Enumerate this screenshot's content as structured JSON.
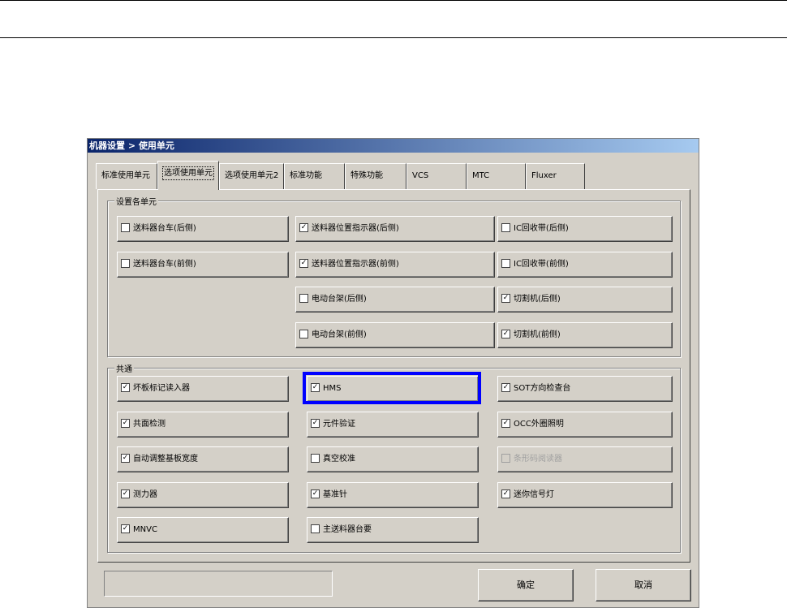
{
  "dialog": {
    "title": "机器设置 > 使用单元",
    "tabs": [
      "标准使用单元",
      "选项使用单元",
      "选项使用单元2",
      "标准功能",
      "特殊功能",
      "VCS",
      "MTC",
      "Fluxer"
    ],
    "selected_tab": 1,
    "group1": {
      "label": "设置各单元",
      "items": [
        {
          "label": "送料器台车(后侧)",
          "checked": false,
          "col": 0,
          "row": 0
        },
        {
          "label": "送料器位置指示器(后侧)",
          "checked": true,
          "col": 1,
          "row": 0
        },
        {
          "label": "IC回收带(后侧)",
          "checked": false,
          "col": 2,
          "row": 0
        },
        {
          "label": "送料器台车(前侧)",
          "checked": false,
          "col": 0,
          "row": 1
        },
        {
          "label": "送料器位置指示器(前侧)",
          "checked": true,
          "col": 1,
          "row": 1
        },
        {
          "label": "IC回收带(前侧)",
          "checked": false,
          "col": 2,
          "row": 1
        },
        {
          "label": "电动台架(后侧)",
          "checked": false,
          "col": 1,
          "row": 2
        },
        {
          "label": "切割机(后侧)",
          "checked": true,
          "col": 2,
          "row": 2
        },
        {
          "label": "电动台架(前侧)",
          "checked": false,
          "col": 1,
          "row": 3
        },
        {
          "label": "切割机(前侧)",
          "checked": true,
          "col": 2,
          "row": 3
        }
      ]
    },
    "group2": {
      "label": "共通",
      "items": [
        {
          "label": "坏板标记读入器",
          "checked": true,
          "col": 0,
          "row": 0
        },
        {
          "label": "HMS",
          "checked": true,
          "col": 1,
          "row": 0
        },
        {
          "label": "SOT方向检查台",
          "checked": true,
          "col": 2,
          "row": 0
        },
        {
          "label": "共面检测",
          "checked": true,
          "col": 0,
          "row": 1
        },
        {
          "label": "元件验证",
          "checked": true,
          "col": 1,
          "row": 1
        },
        {
          "label": "OCC外圈照明",
          "checked": true,
          "col": 2,
          "row": 1
        },
        {
          "label": "自动调整基板宽度",
          "checked": true,
          "col": 0,
          "row": 2
        },
        {
          "label": "真空校准",
          "checked": false,
          "col": 1,
          "row": 2
        },
        {
          "label": "条形码阅读器",
          "checked": false,
          "disabled": true,
          "col": 2,
          "row": 2
        },
        {
          "label": "测力器",
          "checked": true,
          "col": 0,
          "row": 3
        },
        {
          "label": "基准针",
          "checked": true,
          "col": 1,
          "row": 3
        },
        {
          "label": "迷你信号灯",
          "checked": true,
          "col": 2,
          "row": 3
        },
        {
          "label": "MNVC",
          "checked": true,
          "col": 0,
          "row": 4
        },
        {
          "label": "主送料器台要",
          "checked": false,
          "col": 1,
          "row": 4
        }
      ]
    },
    "status_text": "",
    "ok_label": "确定",
    "cancel_label": "取消",
    "highlight_color": "#0000ff"
  }
}
